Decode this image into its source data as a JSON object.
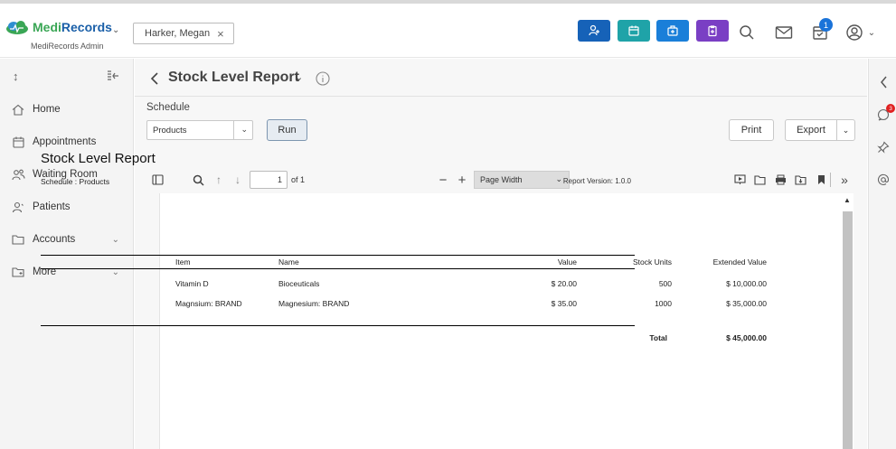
{
  "app": {
    "brand_medi": "Medi",
    "brand_records": "Records",
    "brand_sub": "MediRecords Admin"
  },
  "header": {
    "patient_name": "Harker, Megan",
    "notification_count": "1",
    "action_colors": [
      "#1662b8",
      "#1fa3a8",
      "#1a7fd9",
      "#7a3fc4"
    ]
  },
  "sidebar": {
    "items": [
      {
        "label": "Home",
        "icon": "home-icon"
      },
      {
        "label": "Appointments",
        "icon": "calendar-icon"
      },
      {
        "label": "Waiting Room",
        "icon": "people-icon"
      },
      {
        "label": "Patients",
        "icon": "person-icon"
      },
      {
        "label": "Accounts",
        "icon": "folder-icon"
      },
      {
        "label": "More",
        "icon": "folder-plus-icon"
      }
    ]
  },
  "page": {
    "title": "Stock Level Report",
    "schedule_label": "Schedule",
    "schedule_value": "Products",
    "run_label": "Run",
    "print_label": "Print",
    "export_label": "Export"
  },
  "viewer": {
    "page_number": "1",
    "of_text": "of 1",
    "zoom_value": "Page Width"
  },
  "report": {
    "title": "Stock Level Report",
    "schedule_line": "Schedule : Products",
    "version": "Report Version: 1.0.0",
    "columns": [
      "Item",
      "Name",
      "Value",
      "Stock Units",
      "Extended Value"
    ],
    "rows": [
      {
        "item": "Vitamin D",
        "name": "Bioceuticals",
        "value": "$ 20.00",
        "units": "500",
        "extended": "$ 10,000.00"
      },
      {
        "item": "Magnsium: BRAND",
        "name": "Magnesium: BRAND",
        "value": "$ 35.00",
        "units": "1000",
        "extended": "$ 35,000.00"
      }
    ],
    "total_label": "Total",
    "total_value": "$ 45,000.00"
  },
  "rightbar": {
    "badge_count": "3"
  }
}
